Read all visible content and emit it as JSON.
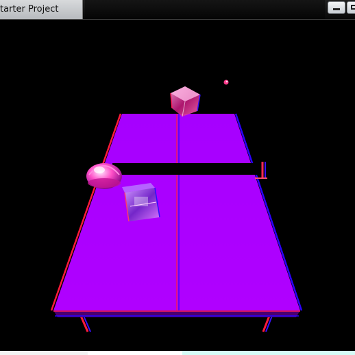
{
  "window": {
    "title": "tarter Project",
    "buttons": [
      "minimize",
      "maximize"
    ]
  },
  "scene": {
    "description_visible": false,
    "colors": {
      "table": "#b000ff",
      "table_edge": "#7a00a8",
      "red_offset": "#ff0030",
      "blue_offset": "#2a00ff",
      "net": "#000000",
      "background": "#000000"
    },
    "objects": {
      "cube_icon": "crystal-cube",
      "ball_icon": "ball",
      "paddle_left_icon": "dome-paddle",
      "paddle_near_icon": "box-paddle"
    }
  }
}
